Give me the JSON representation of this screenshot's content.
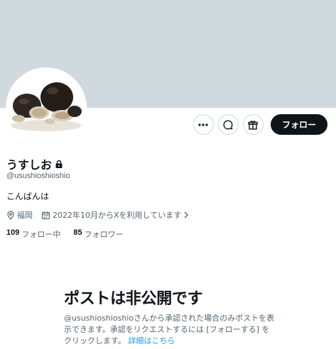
{
  "profile": {
    "display_name": "うすしお",
    "handle": "@usushioshioshio",
    "bio": "こんばんは",
    "location": "福岡",
    "joined": "2022年10月からXを利用しています",
    "following_count": "109",
    "following_label": "フォロー中",
    "followers_count": "85",
    "followers_label": "フォロワー"
  },
  "actions": {
    "more_icon": "more-horizontal-icon",
    "message_icon": "message-bubble-icon",
    "subscribe_icon": "gift-icon",
    "follow_label": "フォロー"
  },
  "protected": {
    "title": "ポストは非公開です",
    "description": "@usushioshioshioさんから承認された場合のみポストを表示できます。承認をリクエストするには [フォローする] をクリックします。",
    "learn_more": "詳細はこちら"
  },
  "colors": {
    "banner": "#cfd9de",
    "text_primary": "#0f1419",
    "text_secondary": "#536471",
    "link": "#1d9bf0",
    "follow_button": "#0f1419"
  }
}
